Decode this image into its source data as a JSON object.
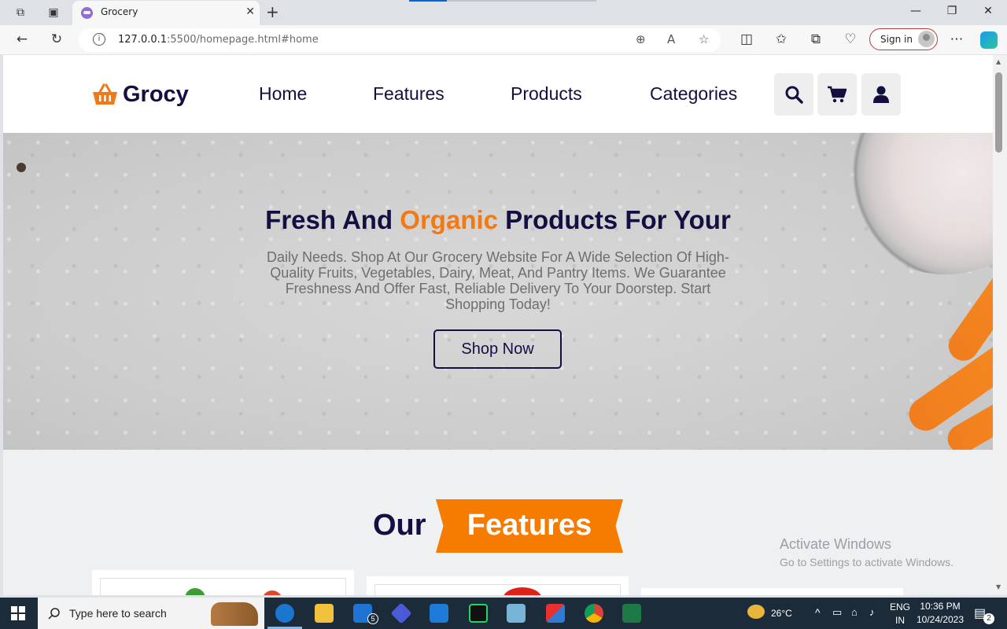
{
  "browser": {
    "tab_title": "Grocery",
    "url_host": "127.0.0.1",
    "url_rest": ":5500/homepage.html#home",
    "signin_label": "Sign in"
  },
  "site": {
    "logo_text": "Grocy",
    "menu": [
      "Home",
      "Features",
      "Products",
      "Categories"
    ],
    "header_icons": [
      "search-icon",
      "cart-icon",
      "user-icon"
    ],
    "accent_color": "#f57c00",
    "brand_color": "#130f40"
  },
  "hero": {
    "title_before": "Fresh And ",
    "title_accent": "Organic",
    "title_after": " Products For Your",
    "description": "Daily Needs. Shop At Our Grocery Website For A Wide Selection Of High-Quality Fruits, Vegetables, Dairy, Meat, And Pantry Items. We Guarantee Freshness And Offer Fast, Reliable Delivery To Your Doorstep. Start Shopping Today!",
    "button_label": "Shop Now"
  },
  "features": {
    "heading_plain": "Our",
    "heading_badge": "Features"
  },
  "watermark": {
    "line1": "Activate Windows",
    "line2": "Go to Settings to activate Windows."
  },
  "taskbar": {
    "search_placeholder": "Type here to search",
    "mail_badge": "5",
    "temperature": "26°C",
    "lang_top": "ENG",
    "lang_bottom": "IN",
    "time": "10:36 PM",
    "date": "10/24/2023",
    "notification_count": "2"
  }
}
